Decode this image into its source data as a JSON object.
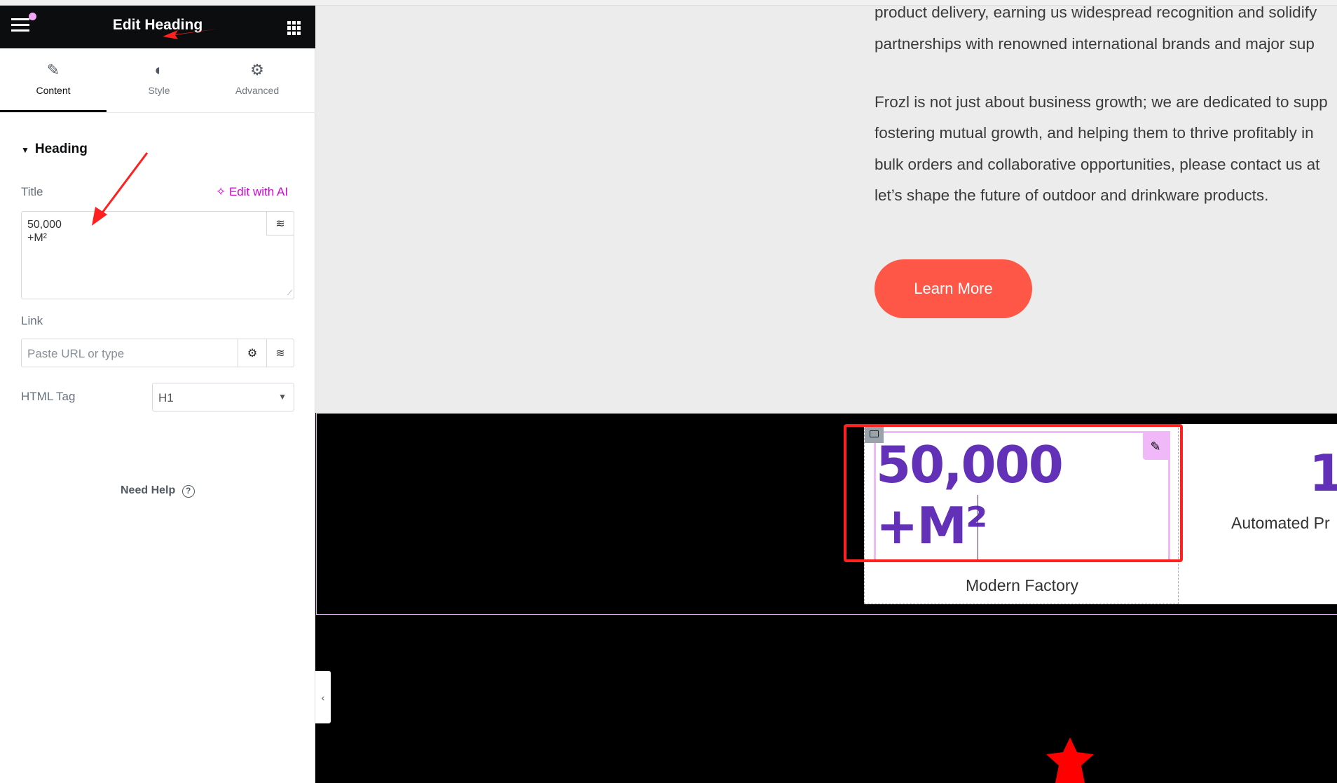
{
  "panel": {
    "title": "Edit Heading",
    "tabs": [
      {
        "label": "Content",
        "icon": "pencil-icon"
      },
      {
        "label": "Style",
        "icon": "contrast-icon"
      },
      {
        "label": "Advanced",
        "icon": "gear-icon"
      }
    ],
    "section": "Heading",
    "title_label": "Title",
    "edit_ai": "Edit with AI",
    "title_value": "50,000\n+M²",
    "link_label": "Link",
    "link_placeholder": "Paste URL or type",
    "html_tag_label": "HTML Tag",
    "html_tag_value": "H1",
    "need_help": "Need Help",
    "accent": "#d004d4"
  },
  "page": {
    "paragraphs": [
      "product delivery, earning us widespread recognition and solidify",
      "partnerships with renowned international brands and major sup",
      "Frozl is not just about business growth; we are dedicated to supp",
      "fostering mutual growth, and helping them to thrive profitably in",
      "bulk orders and collaborative opportunities, please contact us at",
      "let’s shape the future of outdoor and drinkware products."
    ],
    "button": "Learn More",
    "button_color": "#ff5747",
    "stat1_line1": "50,000",
    "stat1_line2": "+M²",
    "stat1_label": "Modern Factory",
    "stat2_partial": "1",
    "stat2_label": "Automated Pr",
    "heading_color": "#6330b8"
  }
}
